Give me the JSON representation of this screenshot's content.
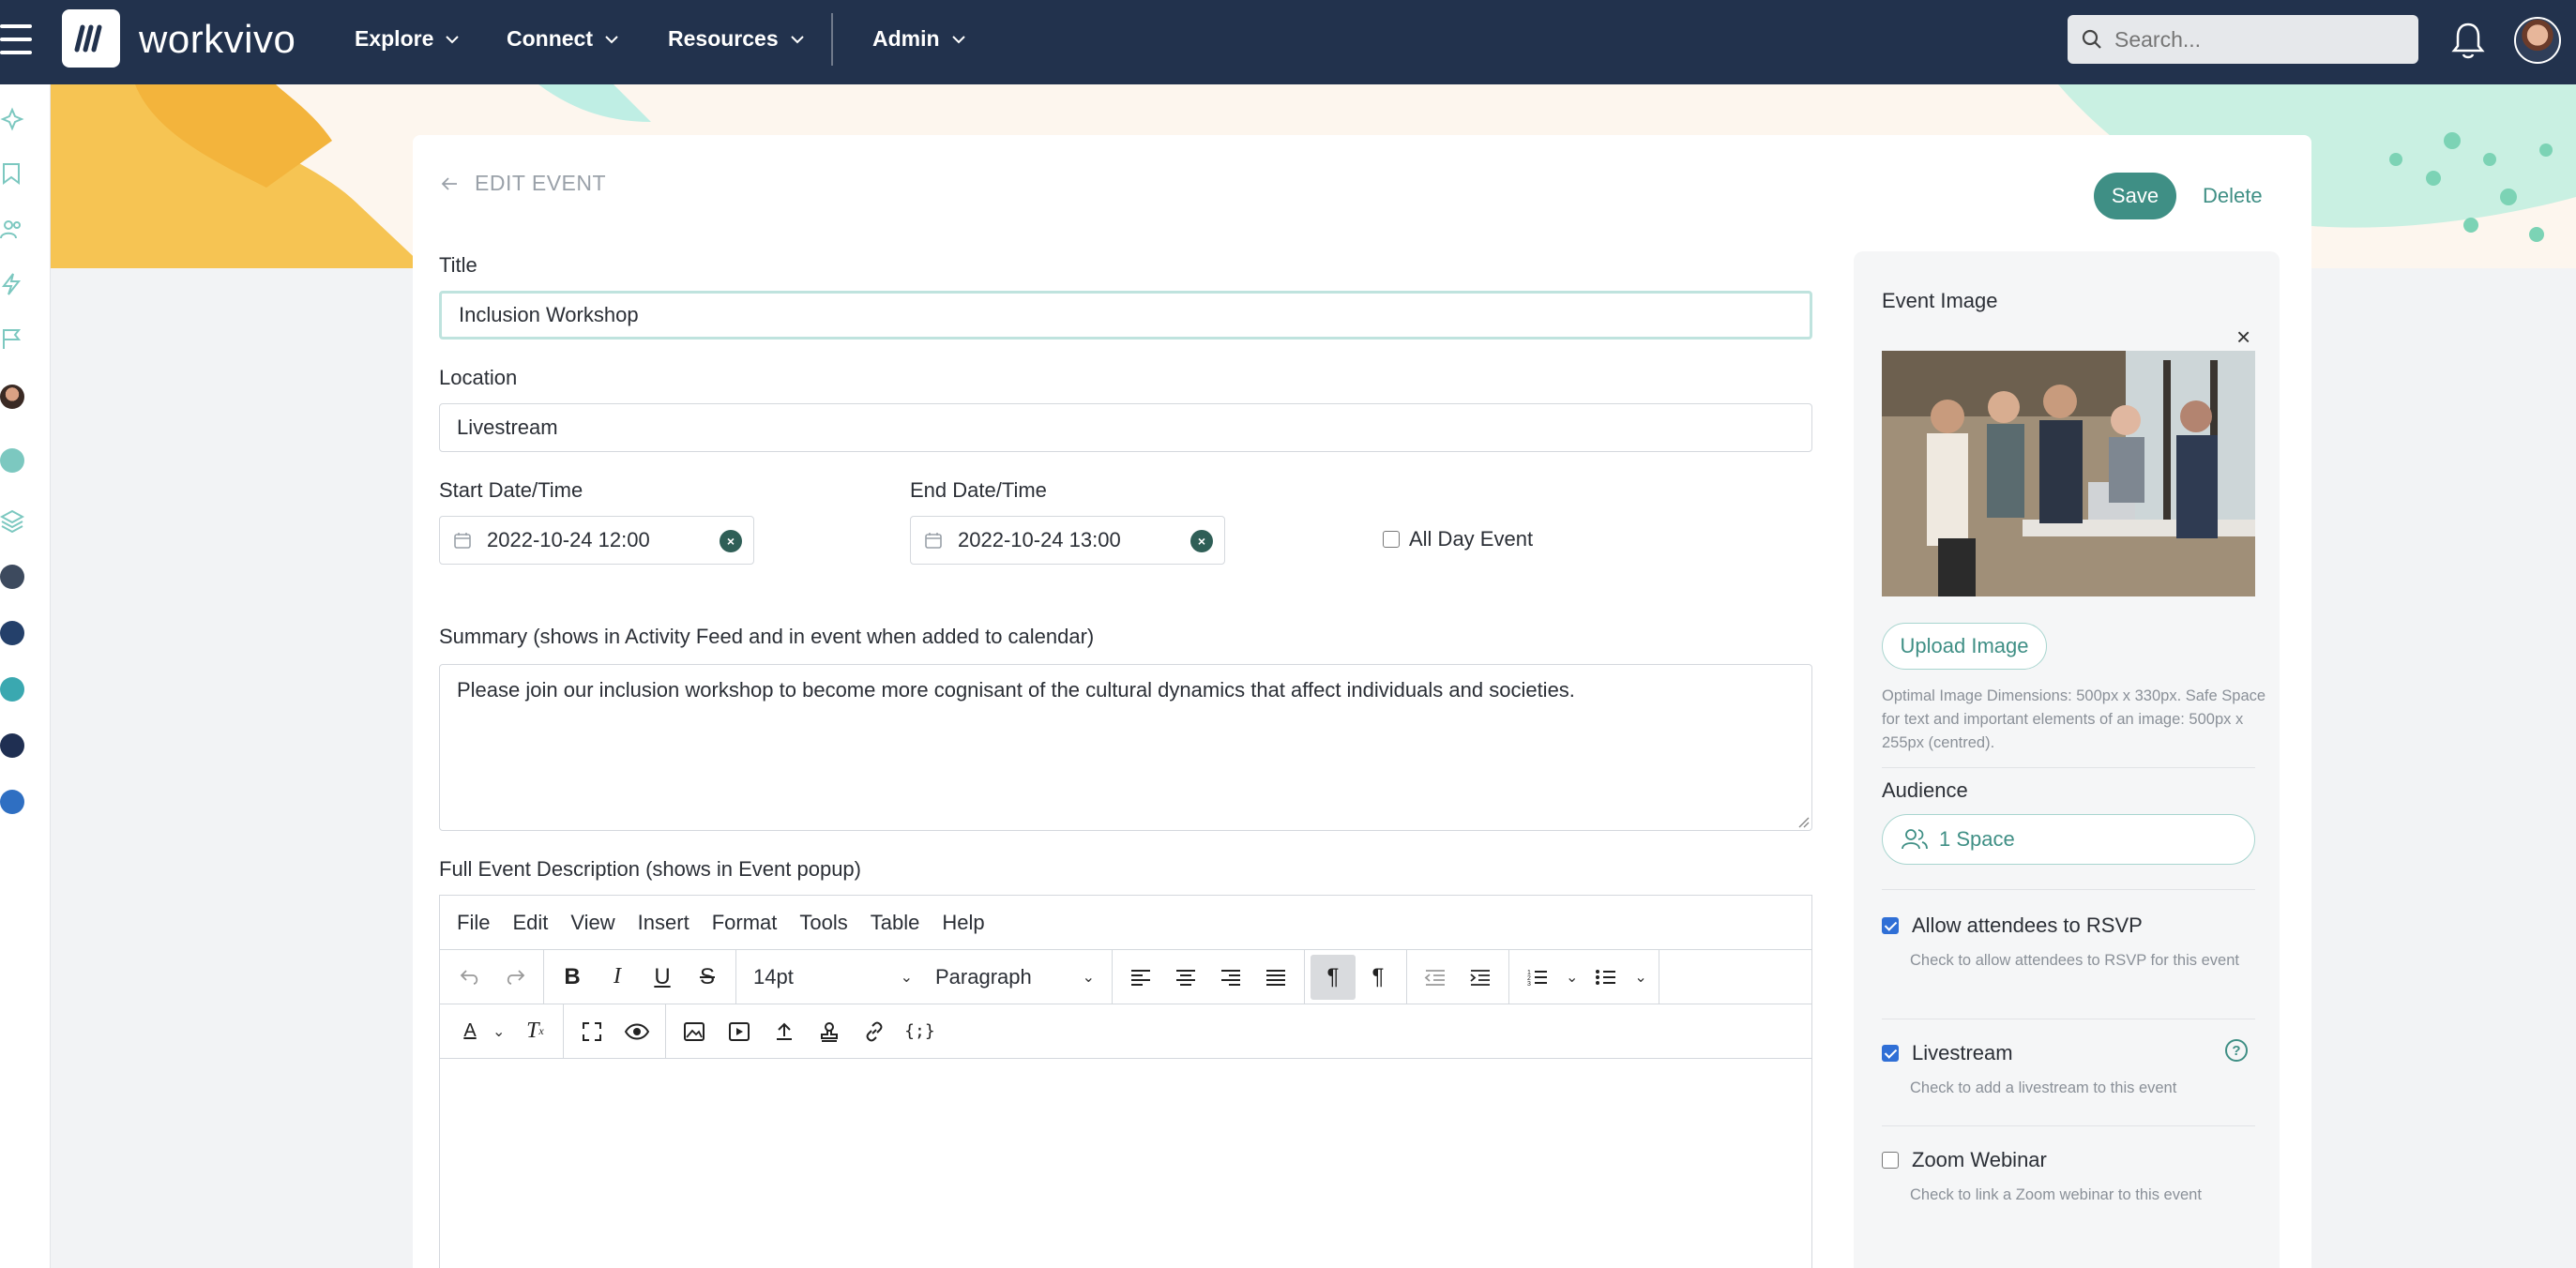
{
  "nav": {
    "logo": "workvivo",
    "items": [
      {
        "label": "Explore"
      },
      {
        "label": "Connect"
      },
      {
        "label": "Resources"
      },
      {
        "label": "Admin"
      }
    ],
    "search_placeholder": "Search..."
  },
  "page": {
    "back_label": "EDIT EVENT",
    "save_label": "Save",
    "delete_label": "Delete"
  },
  "form": {
    "title_label": "Title",
    "title_value": "Inclusion Workshop",
    "location_label": "Location",
    "location_value": "Livestream",
    "start_label": "Start Date/Time",
    "start_value": "2022-10-24 12:00",
    "end_label": "End Date/Time",
    "end_value": "2022-10-24 13:00",
    "all_day_label": "All Day Event",
    "all_day_checked": false,
    "summary_label": "Summary (shows in Activity Feed and in event when added to calendar)",
    "summary_value": "Please join our inclusion workshop to become more cognisant of the cultural dynamics that affect individuals and societies.",
    "description_label": "Full Event Description (shows in Event popup)"
  },
  "editor": {
    "menu": [
      "File",
      "Edit",
      "View",
      "Insert",
      "Format",
      "Tools",
      "Table",
      "Help"
    ],
    "font_size": "14pt",
    "block_format": "Paragraph"
  },
  "side": {
    "image_heading": "Event Image",
    "upload_label": "Upload Image",
    "image_hint": "Optimal Image Dimensions: 500px x 330px. Safe Space for text and important elements of an image: 500px x 255px (centred).",
    "audience_heading": "Audience",
    "audience_value": "1 Space",
    "rsvp_label": "Allow attendees to RSVP",
    "rsvp_hint": "Check to allow attendees to RSVP for this event",
    "rsvp_checked": true,
    "livestream_label": "Livestream",
    "livestream_hint": "Check to add a livestream to this event",
    "livestream_checked": true,
    "zoom_label": "Zoom Webinar",
    "zoom_hint": "Check to link a Zoom webinar to this event",
    "zoom_checked": false
  },
  "colors": {
    "nav_bg": "#22324d",
    "accent": "#3f8f85",
    "banner_yellow": "#f6c453",
    "banner_mint": "#c9f0e2"
  }
}
